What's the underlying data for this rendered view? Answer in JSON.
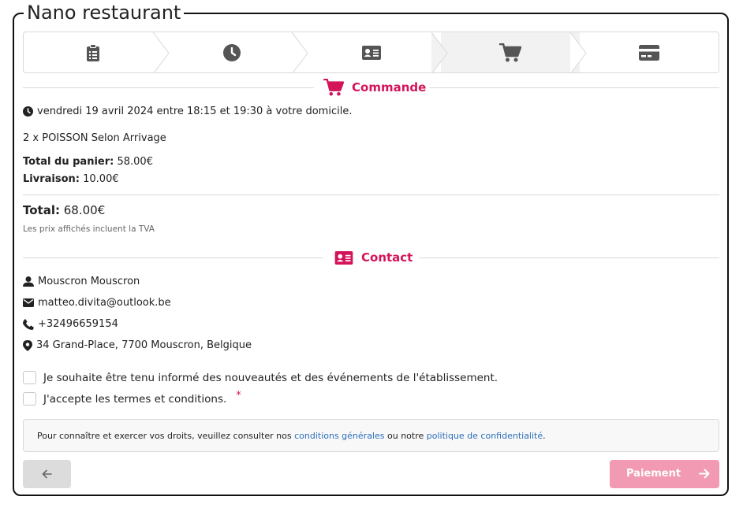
{
  "title": "Nano restaurant",
  "steps": [
    {
      "icon": "clipboard-icon",
      "active": false
    },
    {
      "icon": "clock-icon",
      "active": false
    },
    {
      "icon": "contact-card-icon",
      "active": false
    },
    {
      "icon": "cart-icon",
      "active": true
    },
    {
      "icon": "credit-card-icon",
      "active": false
    }
  ],
  "order": {
    "heading": "Commande",
    "delivery_time": "vendredi 19 avril 2024 entre 18:15 et 19:30 à votre domicile.",
    "item": "2 x POISSON Selon Arrivage",
    "subtotal_label": "Total du panier:",
    "subtotal_value": "58.00€",
    "delivery_label": "Livraison:",
    "delivery_value": "10.00€",
    "total_label": "Total:",
    "total_value": "68.00€",
    "vat_note": "Les prix affichés incluent la TVA"
  },
  "contact": {
    "heading": "Contact",
    "name": "Mouscron Mouscron",
    "email": "matteo.divita@outlook.be",
    "phone": "+32496659154",
    "address": "34 Grand-Place, 7700 Mouscron, Belgique"
  },
  "checkboxes": {
    "newsletter": "Je souhaite être tenu informé des nouveautés et des événements de l'établissement.",
    "terms": "J'accepte les termes et conditions.",
    "required_mark": "*"
  },
  "notice": {
    "prefix": "Pour connaître et exercer vos droits, veuillez consulter nos ",
    "link1": "conditions générales",
    "middle": " ou notre ",
    "link2": "politique de confidentialité",
    "suffix": "."
  },
  "buttons": {
    "pay_label": "Paiement"
  },
  "colors": {
    "accent": "#d4145a",
    "pay_button": "#f29ab3",
    "link": "#2a6ebb"
  }
}
